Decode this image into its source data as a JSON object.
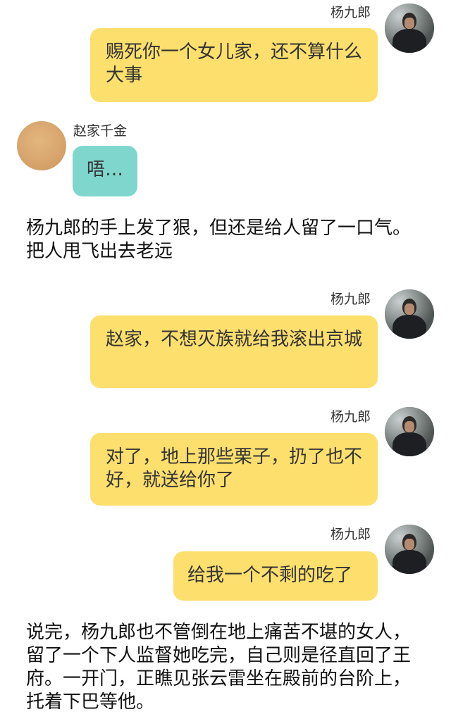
{
  "messages": [
    {
      "speaker": "杨九郎",
      "text": "赐死你一个女儿家，还不算什么大事"
    },
    {
      "speaker": "赵家千金",
      "text": "唔…"
    },
    {
      "speaker": "杨九郎",
      "text": "赵家，不想灭族就给我滚出京城"
    },
    {
      "speaker": "杨九郎",
      "text": "对了，地上那些栗子，扔了也不好，就送给你了"
    },
    {
      "speaker": "杨九郎",
      "text": "给我一个不剩的吃了"
    }
  ],
  "narration": [
    "杨九郎的手上发了狠，但还是给人留了一口气。把人甩飞出去老远",
    "说完，杨九郎也不管倒在地上痛苦不堪的女人，留了一个下人监督她吃完，自己则是径直回了王府。一开门，正瞧见张云雷坐在殿前的台阶上，托着下巴等他。"
  ],
  "colors": {
    "right_bubble": "#fddf6d",
    "left_bubble": "#7fd6cd"
  }
}
